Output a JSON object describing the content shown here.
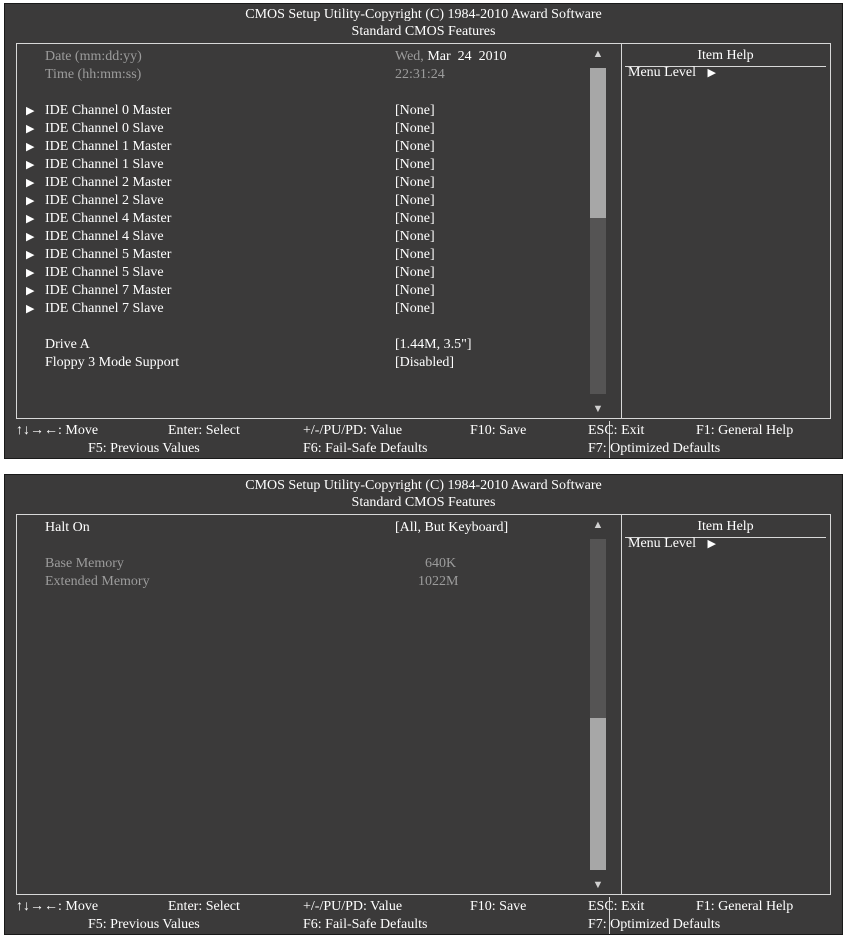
{
  "header": {
    "line1": "CMOS Setup Utility-Copyright (C) 1984-2010 Award Software",
    "line2": "Standard CMOS Features"
  },
  "help": {
    "title": "Item Help",
    "menu_level": "Menu Level"
  },
  "screen1": {
    "date_label": "Date (mm:dd:yy)",
    "date_day": "Wed,",
    "date_value": "Mar  24  2010",
    "time_label": "Time (hh:mm:ss)",
    "time_value": "22:31:24",
    "ide": [
      {
        "label": "IDE Channel 0 Master",
        "value": "[None]"
      },
      {
        "label": "IDE Channel 0 Slave",
        "value": "[None]"
      },
      {
        "label": "IDE Channel 1 Master",
        "value": "[None]"
      },
      {
        "label": "IDE Channel 1 Slave",
        "value": "[None]"
      },
      {
        "label": "IDE Channel 2 Master",
        "value": "[None]"
      },
      {
        "label": "IDE Channel 2 Slave",
        "value": "[None]"
      },
      {
        "label": "IDE Channel 4 Master",
        "value": "[None]"
      },
      {
        "label": "IDE Channel 4 Slave",
        "value": "[None]"
      },
      {
        "label": "IDE Channel 5 Master",
        "value": "[None]"
      },
      {
        "label": "IDE Channel 5 Slave",
        "value": "[None]"
      },
      {
        "label": "IDE Channel 7 Master",
        "value": "[None]"
      },
      {
        "label": "IDE Channel 7 Slave",
        "value": "[None]"
      }
    ],
    "drive_a_label": "Drive A",
    "drive_a_value": "[1.44M, 3.5\"]",
    "floppy_label": "Floppy 3 Mode Support",
    "floppy_value": "[Disabled]",
    "scroll_position": 0.0
  },
  "screen2": {
    "halt_label": "Halt On",
    "halt_value": "[All, But Keyboard]",
    "base_label": "Base Memory",
    "base_value": "640K",
    "ext_label": "Extended Memory",
    "ext_value": "1022M",
    "scroll_position": 1.0
  },
  "footer": {
    "move": "↑↓→←: Move",
    "enter": "Enter: Select",
    "value": "+/-/PU/PD: Value",
    "f10": "F10: Save",
    "esc": "ESC: Exit",
    "f1": "F1: General Help",
    "f5": "F5: Previous Values",
    "f6": "F6: Fail-Safe Defaults",
    "f7": "F7: Optimized Defaults"
  },
  "icons": {
    "submenu_marker": "triangle-right-icon",
    "scroll_up": "triangle-up-icon",
    "scroll_down": "triangle-down-icon"
  },
  "colors": {
    "background": "#3b3a3a",
    "text": "#ffffff",
    "dim_text": "#9c9c9c",
    "scroll_track": "#555454",
    "scroll_thumb": "#a7a7a7"
  }
}
